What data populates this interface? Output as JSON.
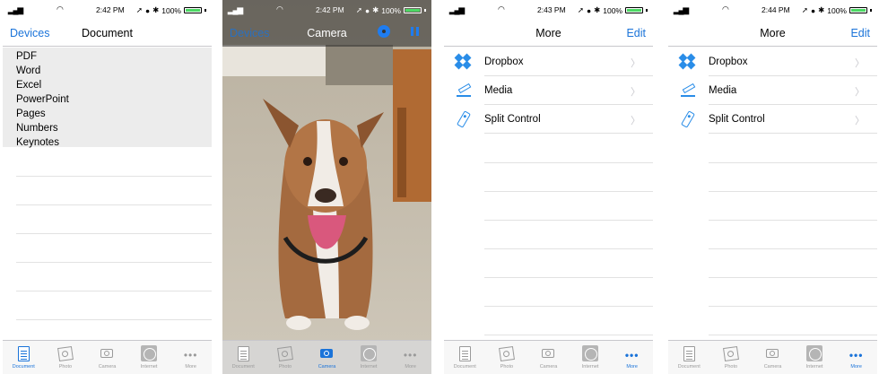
{
  "icons": {
    "tab_document": "document-icon",
    "tab_photo": "photo-icon",
    "tab_camera": "camera-icon",
    "tab_internet": "globe-icon",
    "tab_more": "more-dots-icon",
    "dropbox": "dropbox-icon",
    "media": "media-icon",
    "split_control": "remote-control-icon",
    "settings": "gear-icon",
    "pause": "pause-icon"
  },
  "colors": {
    "accent": "#1a73d9",
    "battery": "#4cd964"
  },
  "tabs": [
    {
      "label": "Document"
    },
    {
      "label": "Photo"
    },
    {
      "label": "Camera"
    },
    {
      "label": "Internet"
    },
    {
      "label": "More"
    }
  ],
  "screen1": {
    "status": {
      "time": "2:42 PM",
      "battery": "100%"
    },
    "nav": {
      "back": "Devices",
      "title": "Document"
    },
    "items": [
      "PDF",
      "Word",
      "Excel",
      "PowerPoint",
      "Pages",
      "Numbers",
      "Keynotes"
    ]
  },
  "screen2": {
    "status": {
      "time": "2:42 PM",
      "battery": "100%"
    },
    "nav": {
      "back": "Devices",
      "title": "Camera"
    }
  },
  "screen3": {
    "status": {
      "time": "2:43 PM",
      "battery": "100%"
    },
    "nav": {
      "title": "More",
      "edit": "Edit"
    },
    "items": [
      "Dropbox",
      "Media",
      "Split Control"
    ]
  },
  "screen4": {
    "status": {
      "time": "2:44 PM",
      "battery": "100%"
    },
    "nav": {
      "title": "More",
      "edit": "Edit"
    },
    "items": [
      "Dropbox",
      "Media",
      "Split Control"
    ]
  }
}
